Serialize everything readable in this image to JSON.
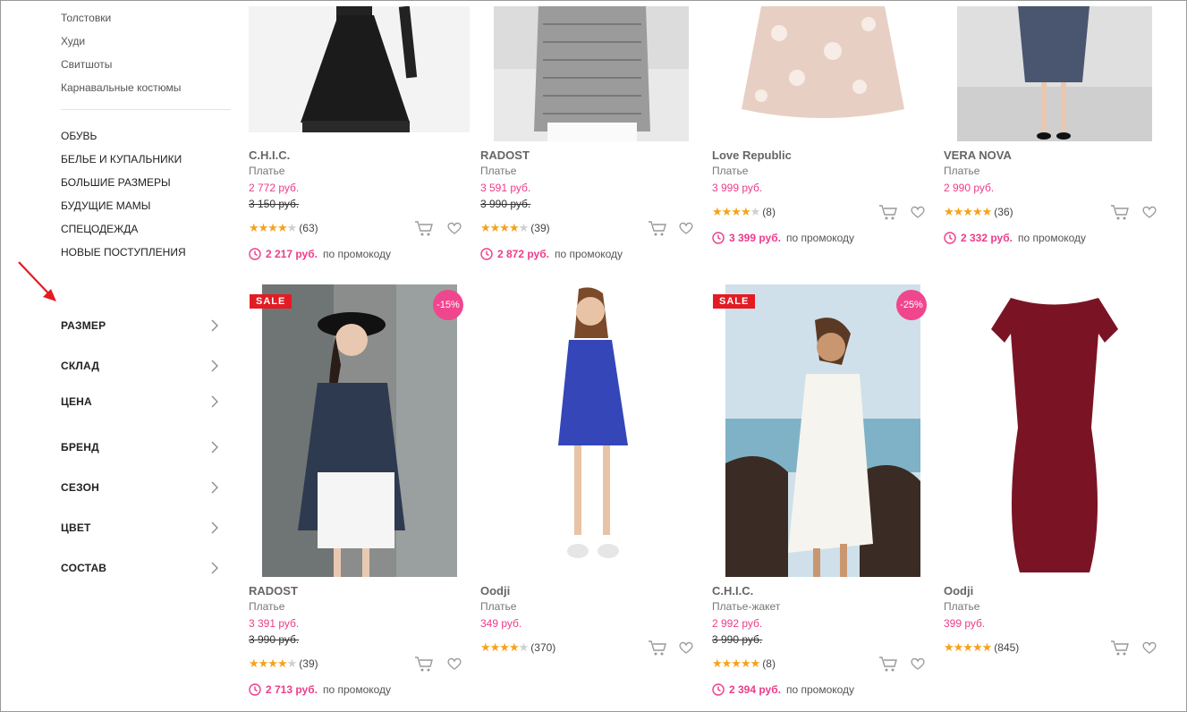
{
  "sidebar": {
    "sub_links": [
      "Толстовки",
      "Худи",
      "Свитшоты",
      "Карнавальные костюмы"
    ],
    "categories": [
      "ОБУВЬ",
      "БЕЛЬЕ И КУПАЛЬНИКИ",
      "БОЛЬШИЕ РАЗМЕРЫ",
      "БУДУЩИЕ МАМЫ",
      "СПЕЦОДЕЖДА",
      "НОВЫЕ ПОСТУПЛЕНИЯ"
    ],
    "filters": [
      "РАЗМЕР",
      "СКЛАД",
      "ЦЕНА",
      "БРЕНД",
      "СЕЗОН",
      "ЦВЕТ",
      "СОСТАВ"
    ]
  },
  "promo_suffix": "по промокоду",
  "products": [
    {
      "brand": "C.H.I.C.",
      "type": "Платье",
      "price": "2 772 руб.",
      "old_price": "3 150 руб.",
      "stars": 4,
      "reviews": "(63)",
      "promo_price": "2 217 руб."
    },
    {
      "brand": "RADOST",
      "type": "Платье",
      "price": "3 591 руб.",
      "old_price": "3 990 руб.",
      "stars": 4,
      "reviews": "(39)",
      "promo_price": "2 872 руб."
    },
    {
      "brand": "Love Republic",
      "type": "Платье",
      "price": "3 999 руб.",
      "old_price": "",
      "stars": 4,
      "reviews": "(8)",
      "promo_price": "3 399 руб."
    },
    {
      "brand": "VERA NOVA",
      "type": "Платье",
      "price": "2 990 руб.",
      "old_price": "",
      "stars": 5,
      "reviews": "(36)",
      "promo_price": "2 332 руб."
    },
    {
      "brand": "RADOST",
      "type": "Платье",
      "price": "3 391 руб.",
      "old_price": "3 990 руб.",
      "stars": 4,
      "reviews": "(39)",
      "promo_price": "2 713 руб.",
      "sale_badge": "SALE",
      "discount": "-15%"
    },
    {
      "brand": "Oodji",
      "type": "Платье",
      "price": "349 руб.",
      "old_price": "",
      "stars": 4,
      "reviews": "(370)",
      "promo_price": ""
    },
    {
      "brand": "C.H.I.C.",
      "type": "Платье-жакет",
      "price": "2 992 руб.",
      "old_price": "3 990 руб.",
      "stars": 5,
      "reviews": "(8)",
      "promo_price": "2 394 руб.",
      "sale_badge": "SALE",
      "discount": "-25%"
    },
    {
      "brand": "Oodji",
      "type": "Платье",
      "price": "399 руб.",
      "old_price": "",
      "stars": 5,
      "reviews": "(845)",
      "promo_price": ""
    }
  ],
  "colors": {
    "accent": "#ec3c8a",
    "sale": "#e41b23",
    "star": "#f6a21a"
  }
}
